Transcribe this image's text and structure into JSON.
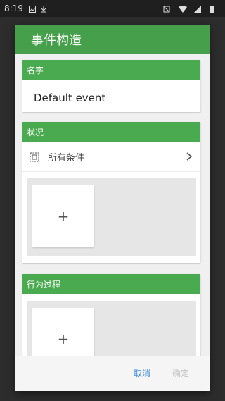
{
  "status_bar": {
    "time": "8:19"
  },
  "dialog": {
    "title": "事件构造",
    "name_section": {
      "label": "名字",
      "value": "Default event"
    },
    "condition_section": {
      "label": "状况",
      "row_label": "所有条件",
      "add_symbol": "+"
    },
    "action_section": {
      "label": "行为过程",
      "add_symbol": "+"
    },
    "buttons": {
      "cancel": "取消",
      "confirm": "确定"
    }
  },
  "colors": {
    "header": "#46a04b",
    "section": "#4aaa4f",
    "cancel": "#4a90e2",
    "disabled": "#c7c7c7"
  }
}
